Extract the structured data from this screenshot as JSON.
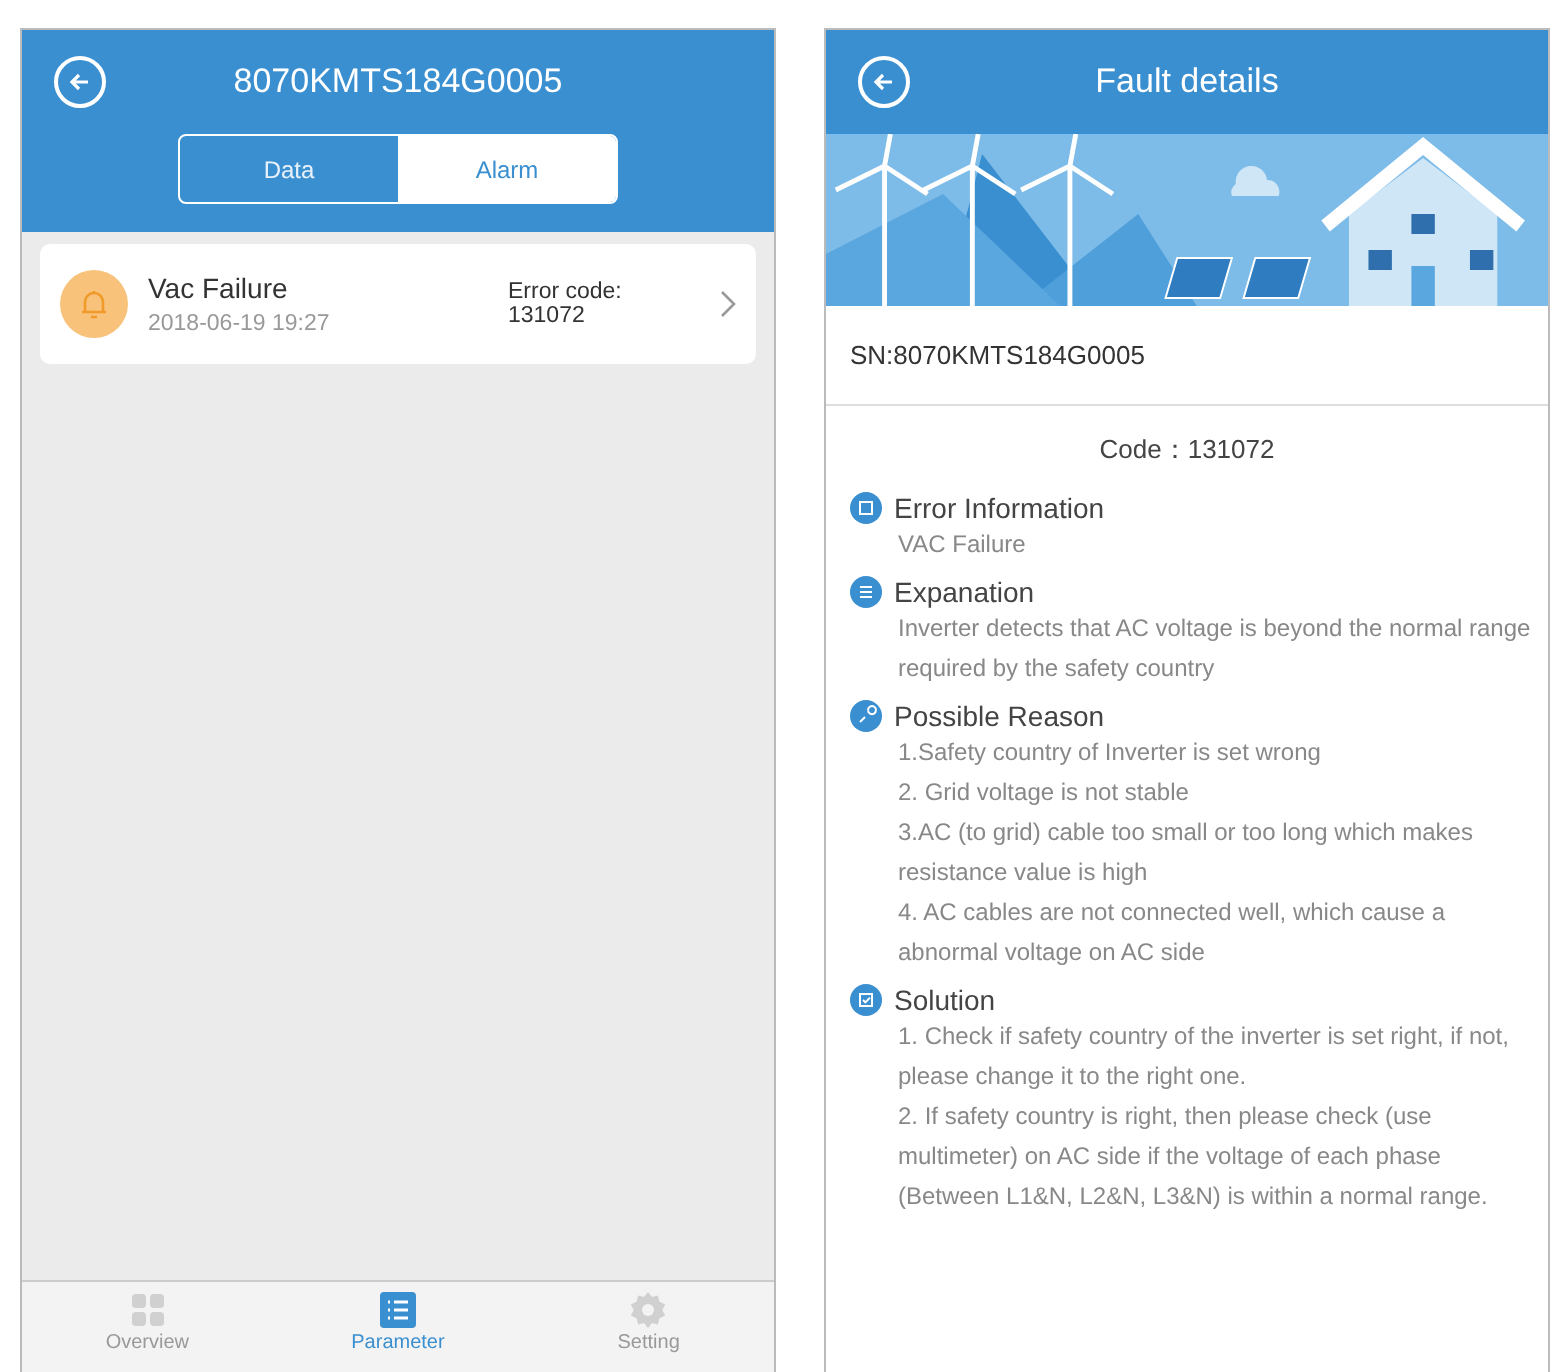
{
  "alarm_screen": {
    "title": "8070KMTS184G0005",
    "tabs": [
      {
        "label": "Data",
        "selected": false
      },
      {
        "label": "Alarm",
        "selected": true
      }
    ],
    "alarms": [
      {
        "name": "Vac Failure",
        "time": "2018-06-19 19:27",
        "code_label": "Error code:",
        "code": "131072"
      }
    ],
    "bottom_nav": [
      {
        "label": "Overview",
        "selected": false
      },
      {
        "label": "Parameter",
        "selected": true
      },
      {
        "label": "Setting",
        "selected": false
      }
    ]
  },
  "fault_screen": {
    "title": "Fault details",
    "sn": "SN:8070KMTS184G0005",
    "code": "Code：131072",
    "sections": [
      {
        "heading": "Error Information",
        "lines": [
          "VAC Failure"
        ]
      },
      {
        "heading": "Expanation",
        "lines": [
          "Inverter detects that AC voltage is beyond the normal range required by the safety country"
        ]
      },
      {
        "heading": "Possible Reason",
        "lines": [
          "1.Safety country of Inverter is set wrong",
          "2. Grid voltage is not stable",
          "3.AC (to grid) cable too small or too long which makes resistance value is high",
          "4. AC cables are not connected well, which cause a abnormal voltage on AC side"
        ]
      },
      {
        "heading": "Solution",
        "lines": [
          "1. Check if safety country of the inverter is set right, if not, please change it to the right one.",
          "2. If safety country is right, then please check (use multimeter) on AC side if the voltage of each phase (Between L1&N, L2&N, L3&N) is within a normal range."
        ]
      }
    ]
  }
}
